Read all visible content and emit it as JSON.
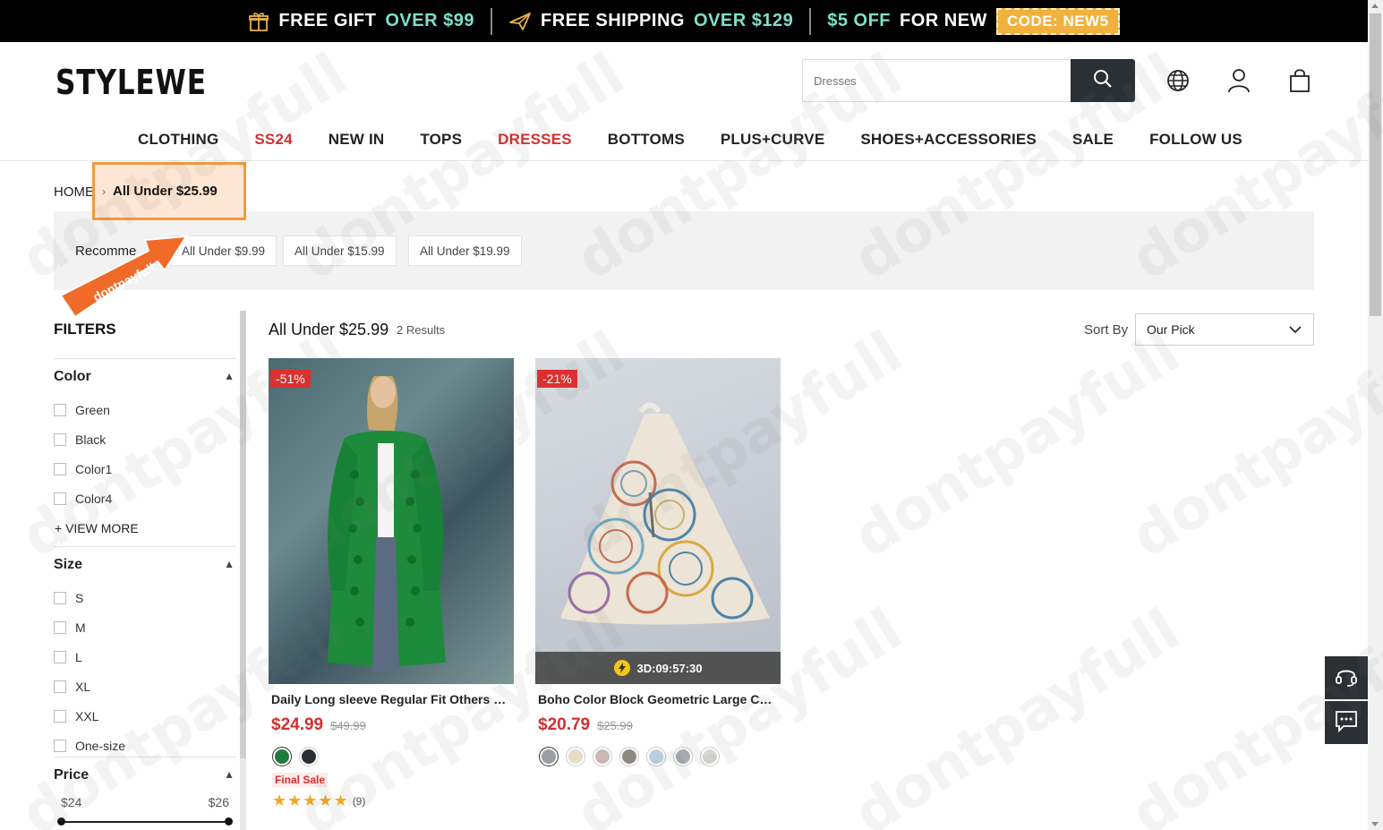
{
  "promo": {
    "gift_label": "FREE GIFT",
    "gift_value": "OVER $99",
    "ship_label": "FREE SHIPPING",
    "ship_value": "OVER $129",
    "off_value": "$5 OFF",
    "off_label": "FOR NEW",
    "code": "CODE: NEW5"
  },
  "header": {
    "logo": "STYLEWE",
    "search_placeholder": "Dresses"
  },
  "nav": {
    "items": [
      {
        "label": "CLOTHING",
        "highlight": false
      },
      {
        "label": "SS24",
        "highlight": true
      },
      {
        "label": "NEW IN",
        "highlight": false
      },
      {
        "label": "TOPS",
        "highlight": false
      },
      {
        "label": "DRESSES",
        "highlight": true
      },
      {
        "label": "BOTTOMS",
        "highlight": false
      },
      {
        "label": "PLUS+CURVE",
        "highlight": false
      },
      {
        "label": "SHOES+ACCESSORIES",
        "highlight": false
      },
      {
        "label": "SALE",
        "highlight": false
      },
      {
        "label": "FOLLOW US",
        "highlight": false
      }
    ]
  },
  "breadcrumb": {
    "home": "HOME",
    "current": "All Under $25.99"
  },
  "recommend": {
    "label": "Recomme",
    "chips": [
      "All Under $9.99",
      "All Under $15.99",
      "All Under $19.99"
    ]
  },
  "watermark_arrow_text": "dontpayfull",
  "filters": {
    "title": "FILTERS",
    "color": {
      "title": "Color",
      "options": [
        "Green",
        "Black",
        "Color1",
        "Color4"
      ],
      "view_more": "+ VIEW MORE"
    },
    "size": {
      "title": "Size",
      "options": [
        "S",
        "M",
        "L",
        "XL",
        "XXL",
        "One-size"
      ]
    },
    "price": {
      "title": "Price",
      "min": "$24",
      "max": "$26"
    }
  },
  "results": {
    "title": "All Under $25.99",
    "count": "2 Results",
    "sort_label": "Sort By",
    "sort_value": "Our Pick"
  },
  "products": [
    {
      "badge": "-51%",
      "name": "Daily Long sleeve Regular Fit Others Sweater",
      "price": "$24.99",
      "was": "$49.99",
      "swatches": [
        "#1f7a3e",
        "#2a2f36"
      ],
      "final_sale": "Final Sale",
      "stars": "★★★★★",
      "reviews": "(9)"
    },
    {
      "badge": "-21%",
      "name": "Boho Color Block Geometric Large Capacity Bag",
      "price": "$20.79",
      "was": "$25.99",
      "timer": "3D:09:57:30",
      "swatches": [
        "#9a9fa6",
        "#e8dcc5",
        "#c9b9b0",
        "#8c8a80",
        "#b9d0df",
        "#a7aab2",
        "#d9d7d3"
      ]
    }
  ],
  "colors": {
    "accent_red": "#d32f2f",
    "promo_teal": "#7fe0c8",
    "code_gold": "#f0b23c",
    "dark": "#2b2f36",
    "highlight_orange": "#f39a3c"
  }
}
